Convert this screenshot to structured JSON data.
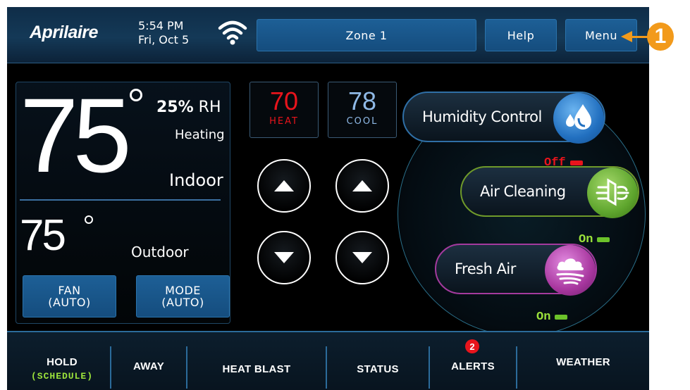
{
  "header": {
    "brand": "Aprilaire",
    "time": "5:54 PM",
    "date": "Fri, Oct 5",
    "wifi_icon": "wifi-icon",
    "zone_label": "Zone 1",
    "help_label": "Help",
    "menu_label": "Menu"
  },
  "callout": {
    "number": "1",
    "color": "#f29a1b"
  },
  "conditions": {
    "indoor_temp": "75",
    "humidity_value": "25%",
    "humidity_unit": "RH",
    "system_status": "Heating",
    "indoor_label": "Indoor",
    "outdoor_temp": "75",
    "outdoor_label": "Outdoor"
  },
  "controls": {
    "fan_label": "FAN",
    "fan_value": "(AUTO)",
    "mode_label": "MODE",
    "mode_value": "(AUTO)"
  },
  "setpoints": {
    "heat_value": "70",
    "heat_label": "HEAT",
    "cool_value": "78",
    "cool_label": "COOL",
    "heat_color": "#e8141c",
    "cool_color": "#8fb9e6"
  },
  "iaq": {
    "humidity_control": {
      "label": "Humidity Control",
      "status": "Off",
      "icon": "water-drops-icon",
      "color": "#2270c0"
    },
    "air_cleaning": {
      "label": "Air Cleaning",
      "status": "On",
      "icon": "air-filter-icon",
      "color": "#5fa62e"
    },
    "fresh_air": {
      "label": "Fresh Air",
      "status": "On",
      "icon": "cloud-wind-icon",
      "color": "#a8379f"
    }
  },
  "nav": {
    "hold_label": "HOLD",
    "hold_sub": "(SCHEDULE)",
    "away_label": "AWAY",
    "heat_blast_label": "HEAT BLAST",
    "status_label": "STATUS",
    "alerts_label": "ALERTS",
    "alerts_count": "2",
    "weather_label": "WEATHER"
  }
}
